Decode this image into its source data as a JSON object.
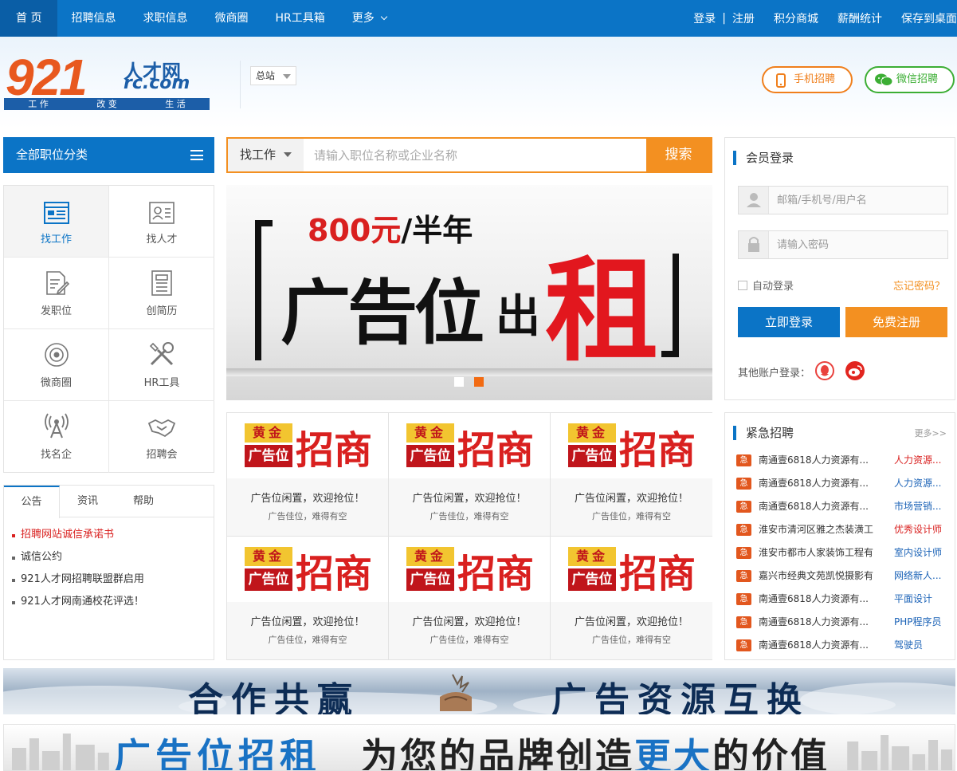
{
  "topnav": {
    "items": [
      "首 页",
      "招聘信息",
      "求职信息",
      "微商圈",
      "HR工具箱",
      "更多"
    ],
    "right": [
      "登录",
      "|",
      "注册",
      "积分商城",
      "薪酬统计",
      "保存到桌面"
    ]
  },
  "logo": {
    "number": "921",
    "cn": "人才网",
    "domain": "rc.com",
    "slogan": [
      "工 作",
      "改 变",
      "生 活"
    ]
  },
  "site_select": "总站",
  "header_buttons": {
    "mobile": "手机招聘",
    "wechat": "微信招聘"
  },
  "category": {
    "label": "全部职位分类"
  },
  "quick_menu": [
    {
      "label": "找工作",
      "icon": "job-list-icon"
    },
    {
      "label": "找人才",
      "icon": "resume-card-icon"
    },
    {
      "label": "发职位",
      "icon": "post-job-icon"
    },
    {
      "label": "创简历",
      "icon": "document-icon"
    },
    {
      "label": "微商圈",
      "icon": "target-icon"
    },
    {
      "label": "HR工具",
      "icon": "tools-icon"
    },
    {
      "label": "找名企",
      "icon": "signal-tower-icon"
    },
    {
      "label": "招聘会",
      "icon": "handshake-icon"
    }
  ],
  "info_tabs": {
    "tabs": [
      "公告",
      "资讯",
      "帮助"
    ],
    "items": [
      "招聘网站诚信承诺书",
      "诚信公约",
      "921人才网招聘联盟群启用",
      "921人才网南通校花评选！"
    ]
  },
  "search": {
    "type": "找工作",
    "placeholder": "请输入职位名称或企业名称",
    "button": "搜索"
  },
  "banner": {
    "price_num": "800元",
    "price_rest": "/半年",
    "big": "广告位",
    "chu": "出",
    "zu": "租"
  },
  "ads": {
    "gold_top": "黄金",
    "gold_bottom": "广告位",
    "headline": "招商",
    "items": [
      {
        "line1": "广告位闲置，欢迎抢位！",
        "line2": "广告佳位，难得有空"
      },
      {
        "line1": "广告位闲置，欢迎抢位！",
        "line2": "广告佳位，难得有空"
      },
      {
        "line1": "广告位闲置，欢迎抢位！",
        "line2": "广告佳位，难得有空"
      },
      {
        "line1": "广告位闲置，欢迎抢位！",
        "line2": "广告佳位，难得有空"
      },
      {
        "line1": "广告位闲置，欢迎抢位！",
        "line2": "广告佳位，难得有空"
      },
      {
        "line1": "广告位闲置，欢迎抢位！",
        "line2": "广告佳位，难得有空"
      }
    ]
  },
  "login": {
    "title": "会员登录",
    "username_placeholder": "邮箱/手机号/用户名",
    "password_placeholder": "请输入密码",
    "remember": "自动登录",
    "forgot": "忘记密码？",
    "login_button": "立即登录",
    "register_button": "免费注册",
    "other": "其他账户登录："
  },
  "urgent": {
    "title": "紧急招聘",
    "more": "更多>>",
    "badge": "急",
    "rows": [
      {
        "company": "南通壹6818人力资源有...",
        "job": "人力资源..."
      },
      {
        "company": "南通壹6818人力资源有...",
        "job": "人力资源..."
      },
      {
        "company": "南通壹6818人力资源有...",
        "job": "市场营销..."
      },
      {
        "company": "淮安市清河区雅之杰装潢工",
        "job": "优秀设计师"
      },
      {
        "company": "淮安市都市人家装饰工程有",
        "job": "室内设计师"
      },
      {
        "company": "嘉兴市经典文苑凯悦摄影有",
        "job": "网络新人..."
      },
      {
        "company": "南通壹6818人力资源有...",
        "job": "平面设计"
      },
      {
        "company": "南通壹6818人力资源有...",
        "job": "PHP程序员"
      },
      {
        "company": "南通壹6818人力资源有...",
        "job": "驾驶员"
      }
    ]
  },
  "bottom_banner1": {
    "left": "合作共赢",
    "right": "广告资源互换"
  },
  "bottom_banner2": {
    "left": "广告位招租",
    "mid": "为您的品牌创造",
    "em": "更大",
    "end": "的价值"
  },
  "colors": {
    "primary": "#0b74c6",
    "accent": "#f39021",
    "red": "#d9201f",
    "green": "#3cae34"
  }
}
